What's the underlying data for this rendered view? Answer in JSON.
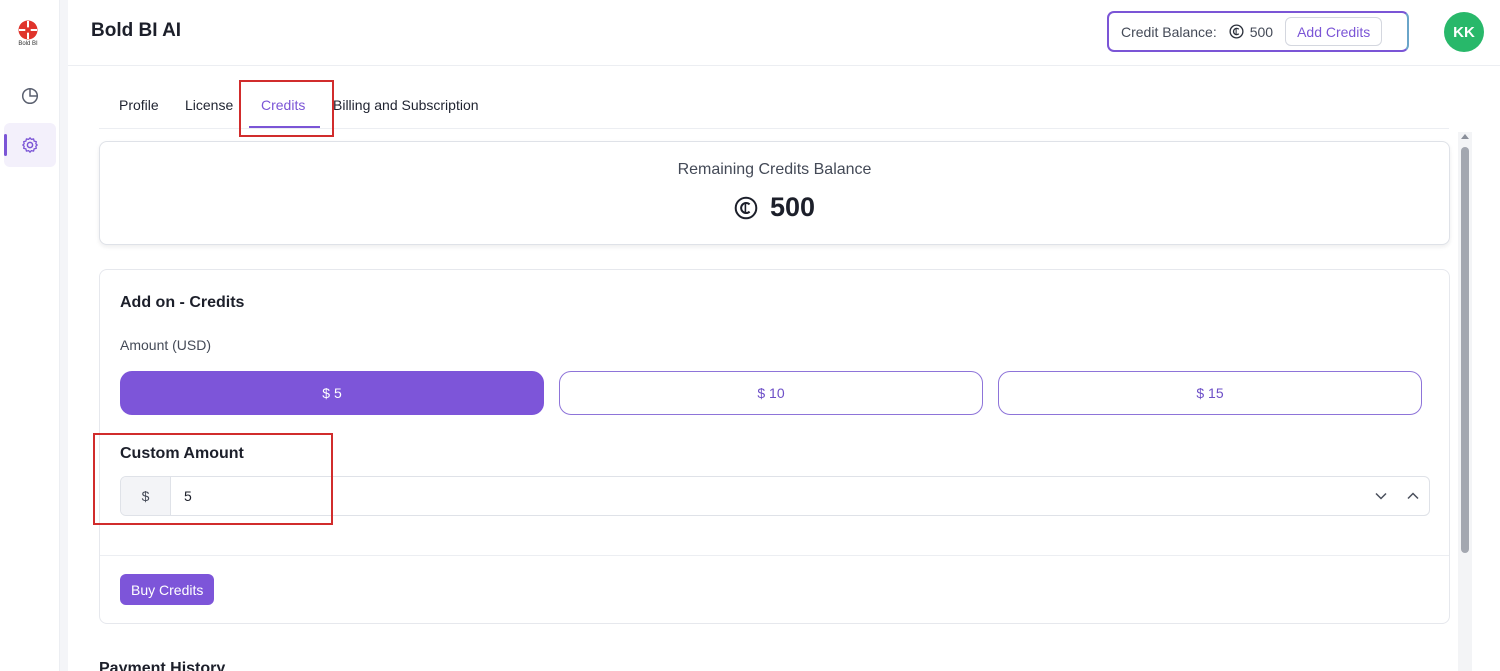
{
  "app": {
    "title": "Bold BI AI",
    "logo_text": "Bold BI"
  },
  "sidebar": {
    "items": [
      {
        "name": "dashboards",
        "icon": "pie-chart-icon",
        "active": false
      },
      {
        "name": "settings",
        "icon": "gear-icon",
        "active": true
      }
    ]
  },
  "header": {
    "credit_balance_label": "Credit Balance:",
    "credit_balance_value": "500",
    "add_credits_label": "Add Credits",
    "avatar_initials": "KK",
    "accent_color": "#7b55d6",
    "avatar_color": "#28b86a"
  },
  "tabs": [
    {
      "label": "Profile",
      "active": false
    },
    {
      "label": "License",
      "active": false
    },
    {
      "label": "Credits",
      "active": true
    },
    {
      "label": "Billing and Subscription",
      "active": false
    }
  ],
  "balance_card": {
    "label": "Remaining Credits Balance",
    "value": "500"
  },
  "addon": {
    "title": "Add on - Credits",
    "amount_label": "Amount (USD)",
    "options": [
      {
        "label": "$ 5",
        "selected": true
      },
      {
        "label": "$ 10",
        "selected": false
      },
      {
        "label": "$ 15",
        "selected": false
      }
    ],
    "custom_label": "Custom Amount",
    "currency_prefix": "$",
    "custom_value": "5",
    "buy_label": "Buy Credits"
  },
  "next_section": {
    "title": "Payment History"
  }
}
